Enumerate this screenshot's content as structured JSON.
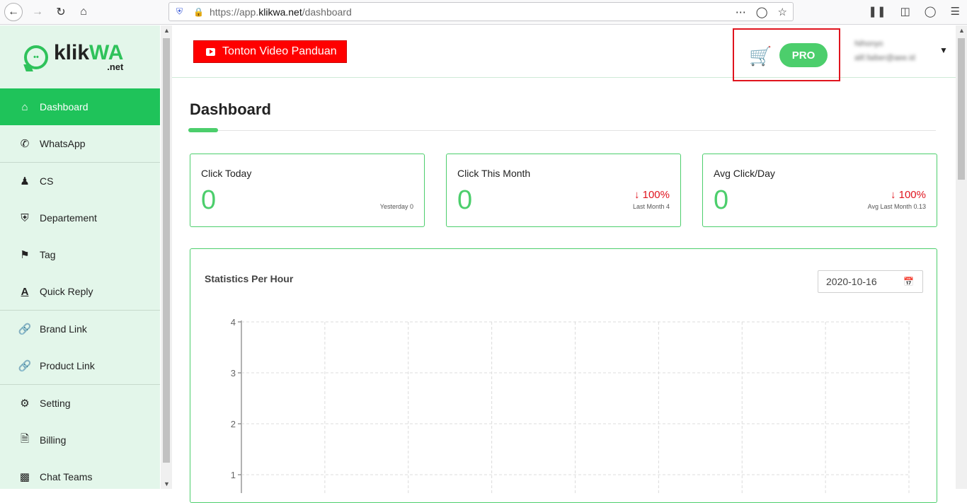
{
  "browser": {
    "url_prefix": "https://app.",
    "url_host": "klikwa.net",
    "url_path": "/dashboard"
  },
  "brand": {
    "logo_k": "klik",
    "logo_wa": "WA",
    "logo_net": ".net"
  },
  "sidebar": {
    "items": [
      {
        "label": "Dashboard"
      },
      {
        "label": "WhatsApp"
      },
      {
        "label": "CS"
      },
      {
        "label": "Departement"
      },
      {
        "label": "Tag"
      },
      {
        "label": "Quick Reply"
      },
      {
        "label": "Brand Link"
      },
      {
        "label": "Product Link"
      },
      {
        "label": "Setting"
      },
      {
        "label": "Billing"
      },
      {
        "label": "Chat Teams"
      }
    ]
  },
  "header": {
    "video_button": "Tonton Video Panduan",
    "plan_badge": "PRO",
    "user_name": "Nihonyo",
    "user_email": "alif.faiber@aee.id"
  },
  "page": {
    "title": "Dashboard"
  },
  "stats": [
    {
      "label": "Click Today",
      "value": "0",
      "change": "",
      "sub": "Yesterday 0"
    },
    {
      "label": "Click This Month",
      "value": "0",
      "change": "100%",
      "sub": "Last Month 4"
    },
    {
      "label": "Avg Click/Day",
      "value": "0",
      "change": "100%",
      "sub": "Avg Last Month 0.13"
    }
  ],
  "chart": {
    "title": "Statistics Per Hour",
    "date": "2020-10-16"
  },
  "chart_data": {
    "type": "line",
    "title": "Statistics Per Hour",
    "xlabel": "",
    "ylabel": "",
    "ylim": [
      0,
      4
    ],
    "yticks": [
      1,
      2,
      3,
      4
    ],
    "grid": true,
    "x": [],
    "series": []
  },
  "colors": {
    "accent": "#4cce6c",
    "active": "#1fc35a",
    "red": "#e0141e",
    "sidebar_bg": "#e3f6ea"
  }
}
